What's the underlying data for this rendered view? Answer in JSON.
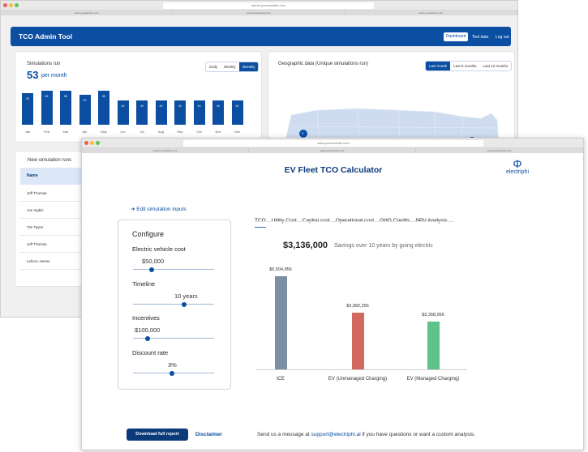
{
  "back": {
    "url": "admin.yourwebsite.com",
    "tabs": [
      "www.yourwebsite.com",
      "www.yourwebsite.com",
      "www.yourwebsite.com"
    ],
    "app_title": "TCO Admin Tool",
    "nav": [
      "Dashboard",
      "Tool data",
      "Log out"
    ],
    "sim": {
      "title": "Simulations run",
      "value": "53",
      "unit": "per month",
      "toggle": [
        "Daily",
        "Weekly",
        "Monthly"
      ]
    },
    "geo": {
      "title": "Geographic data (Unique simulations run)",
      "toggle": [
        "Last month",
        "Last 6 months",
        "Last 12 months"
      ],
      "marker1": "3",
      "marker2": "2"
    },
    "bars": [
      {
        "month": "Jan",
        "value": "20",
        "h": 39
      },
      {
        "month": "Feb",
        "value": "55",
        "h": 42
      },
      {
        "month": "Mar",
        "value": "55",
        "h": 42
      },
      {
        "month": "Apr",
        "value": "30",
        "h": 37
      },
      {
        "month": "May",
        "value": "55",
        "h": 42
      },
      {
        "month": "Jun",
        "value": "40",
        "h": 30
      },
      {
        "month": "Jul",
        "value": "40",
        "h": 30
      },
      {
        "month": "Aug",
        "value": "40",
        "h": 30
      },
      {
        "month": "Sep",
        "value": "40",
        "h": 30
      },
      {
        "month": "Oct",
        "value": "40",
        "h": 30
      },
      {
        "month": "Nov",
        "value": "40",
        "h": 30
      },
      {
        "month": "Dec",
        "value": "40",
        "h": 30
      }
    ],
    "runs": {
      "title": "New simulation runs",
      "header": "Name",
      "names": [
        "Jeff Thomas",
        "Joe Ingkin",
        "Tim Taylor",
        "Jeff Thomas",
        "Lebron James"
      ]
    }
  },
  "front": {
    "url": "www.yourwebsite.com",
    "tabs": [
      "www.yourwebsite.com",
      "www.yourwebsite.com",
      "www.yourwebsite.com"
    ],
    "title": "EV Fleet TCO Calculator",
    "logo_text": "electriphi",
    "edit_link": "Edit simulation inputs",
    "configure": {
      "heading": "Configure",
      "fields": [
        {
          "label": "Electric vehicle cost",
          "value": "$50,000",
          "level": 0.2
        },
        {
          "label": "Timeline",
          "value": "10 years",
          "level": 0.6
        },
        {
          "label": "Incentives",
          "value": "$100,000",
          "level": 0.15
        },
        {
          "label": "Discount rate",
          "value": "3%",
          "level": 0.45
        }
      ]
    },
    "tabs_main": [
      "TCO",
      "Utility Cost",
      "Capital cost",
      "Operational cost",
      "GHG Credits",
      "NPV Analysis"
    ],
    "savings": {
      "amount": "$3,136,000",
      "text": "Savings over 10 years by going electric"
    },
    "download": "Download full report",
    "disclaimer": "Disclaimer",
    "footer_pre": "Send us a message at ",
    "footer_email": "support@electriphi.ai",
    "footer_post": " if you have questions or want a custom analysis.",
    "accent": "#0b4ea2"
  },
  "chart_data": {
    "type": "bar",
    "categories": [
      "ICE",
      "EV (Unmanaged Charging)",
      "EV (Managed Charging)"
    ],
    "values": [
      6504956,
      3982256,
      3368956
    ],
    "value_labels": [
      "$6,504,956",
      "$3,982,256",
      "$3,368,956"
    ],
    "colors": [
      "#7b8fa3",
      "#d06a5e",
      "#5cc38a"
    ],
    "ylim": [
      0,
      6800000
    ],
    "grid": false
  }
}
